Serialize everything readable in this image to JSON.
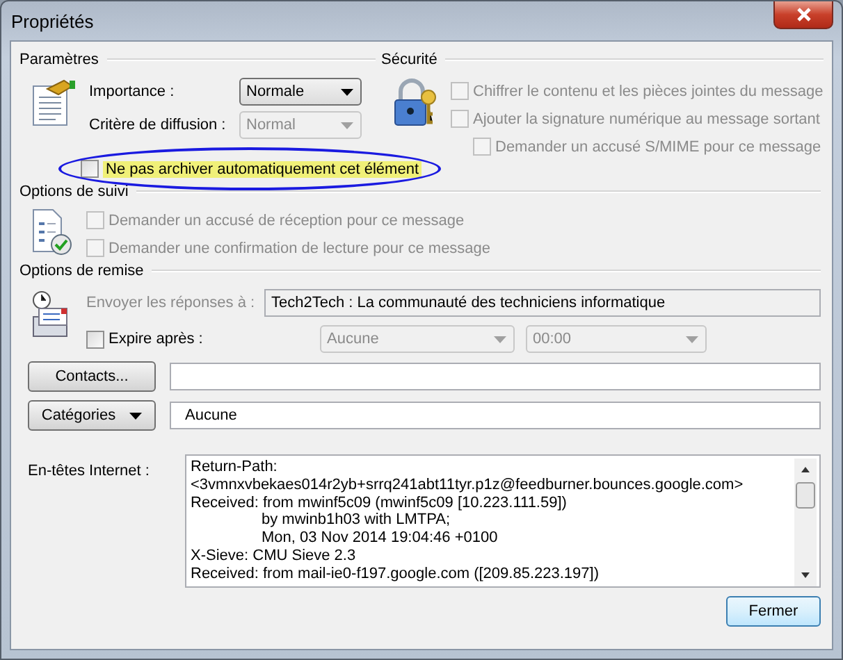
{
  "window": {
    "title": "Propriétés"
  },
  "settings": {
    "heading": "Paramètres",
    "importance_label": "Importance :",
    "importance": {
      "value": "Normale",
      "disabled": false
    },
    "sensitivity_label": "Critère de diffusion :",
    "sensitivity": {
      "value": "Normal",
      "disabled": true
    },
    "archive": {
      "label": "Ne pas archiver automatiquement cet élément",
      "checked": false,
      "highlighted": true
    }
  },
  "security": {
    "heading": "Sécurité",
    "options": [
      {
        "label": "Chiffrer le contenu et les pièces jointes du message",
        "checked": false,
        "disabled": true
      },
      {
        "label": "Ajouter la signature numérique au message sortant",
        "checked": false,
        "disabled": true,
        "children": [
          {
            "label": "Demander un accusé S/MIME pour ce message",
            "checked": false,
            "disabled": true
          }
        ]
      }
    ]
  },
  "tracking": {
    "heading": "Options de suivi",
    "options": [
      {
        "label": "Demander un accusé de réception pour ce message",
        "checked": false,
        "disabled": true
      },
      {
        "label": "Demander une confirmation de lecture pour ce message",
        "checked": false,
        "disabled": true
      }
    ]
  },
  "delivery": {
    "heading": "Options de remise",
    "reply_label": "Envoyer les réponses à :",
    "reply_label_disabled": true,
    "reply_to": "Tech2Tech : La communauté des techniciens informatique",
    "expire": {
      "label": "Expire après :",
      "checked": false
    },
    "expire_date": {
      "value": "Aucune",
      "disabled": true
    },
    "expire_time": {
      "value": "00:00",
      "disabled": true
    }
  },
  "contacts_button": "Contacts...",
  "categories_button": "Catégories",
  "categories_value": "Aucune",
  "headers": {
    "label": "En-têtes Internet :",
    "lines": [
      {
        "text": "Return-Path:",
        "kind": "line"
      },
      {
        "text": "<3vmnxvbekaes014r2yb+srrq241abt11tyr.p1z@feedburner.bounces.google.com>",
        "kind": "line"
      },
      {
        "text": "Received: from mwinf5c09 (mwinf5c09 [10.223.111.59])",
        "kind": "line"
      },
      {
        "text": "by mwinb1h03 with LMTPA;",
        "kind": "continuation"
      },
      {
        "text": "Mon, 03 Nov 2014 19:04:46 +0100",
        "kind": "continuation"
      },
      {
        "text": "X-Sieve: CMU Sieve 2.3",
        "kind": "line"
      },
      {
        "text": "Received: from mail-ie0-f197.google.com ([209.85.223.197])",
        "kind": "line"
      }
    ]
  },
  "close_button": "Fermer"
}
